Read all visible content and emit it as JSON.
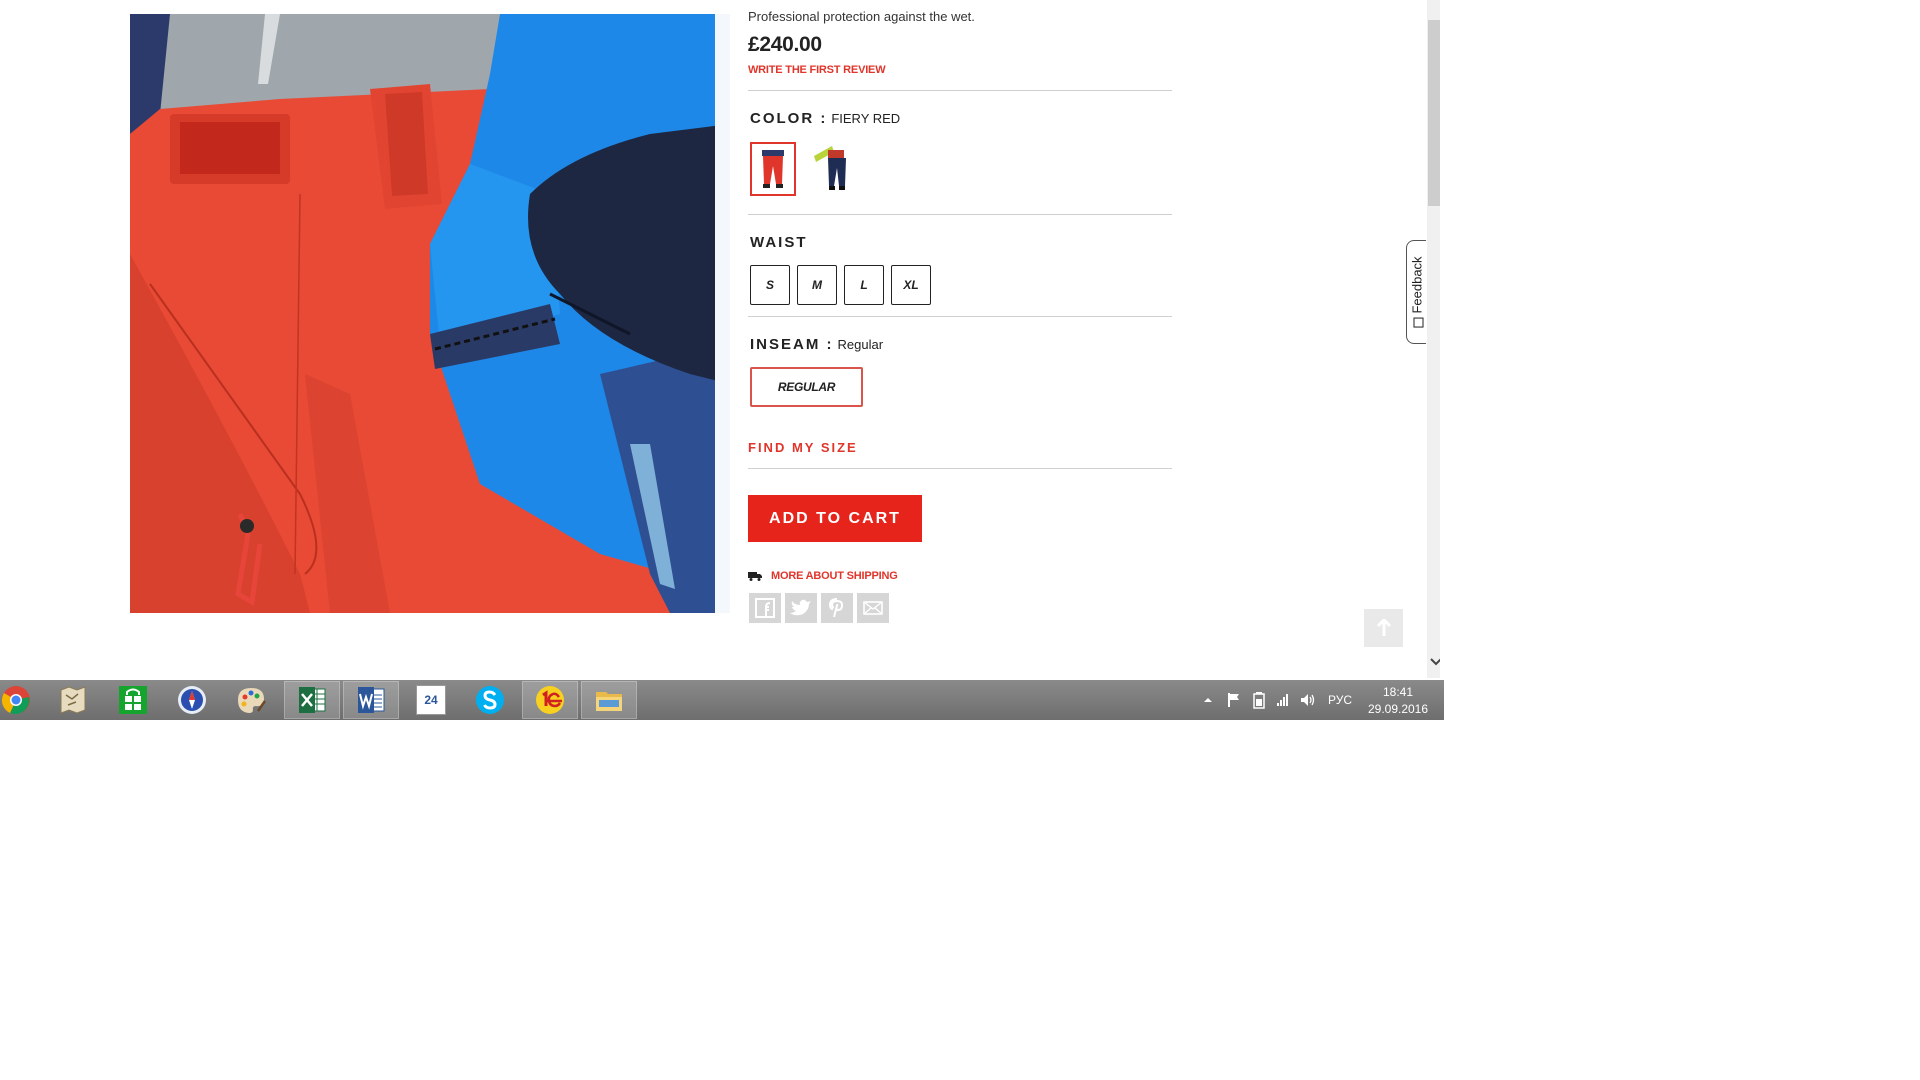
{
  "product": {
    "tagline": "Professional protection against the wet.",
    "price": "£240.00",
    "review_link": "WRITE THE FIRST REVIEW"
  },
  "color": {
    "label": "COLOR  :",
    "value": "FIERY RED",
    "swatches": [
      {
        "name": "fiery-red",
        "selected": true
      },
      {
        "name": "navy-with-board",
        "selected": false
      }
    ]
  },
  "waist": {
    "label": "WAIST",
    "sizes": [
      "S",
      "M",
      "L",
      "XL"
    ]
  },
  "inseam": {
    "label": "INSEAM  :",
    "value": "Regular",
    "options": [
      "REGULAR"
    ]
  },
  "find_size": "FIND MY SIZE",
  "add_to_cart": "ADD TO CART",
  "shipping_link": "MORE ABOUT SHIPPING",
  "share_icons": [
    "facebook-icon",
    "twitter-icon",
    "pinterest-icon",
    "email-icon"
  ],
  "feedback": "Feedback",
  "colors": {
    "accent": "#e0352b",
    "cart_bg": "#e7241c"
  },
  "taskbar": {
    "apps": [
      "chrome-icon",
      "maps-icon",
      "store-icon",
      "safari-icon",
      "paint-icon",
      "excel-icon",
      "word-icon",
      "calendar-icon",
      "skype-icon",
      "1c-icon",
      "explorer-icon"
    ],
    "calendar_day": "24",
    "language": "РУС",
    "time": "18:41",
    "date": "29.09.2016"
  }
}
